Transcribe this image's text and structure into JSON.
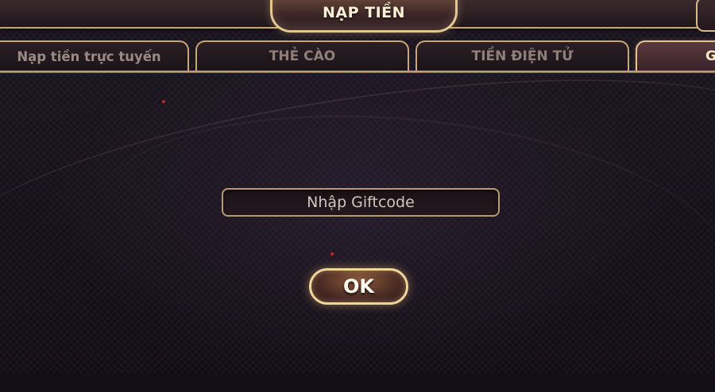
{
  "header": {
    "title": "NẠP TIỀN"
  },
  "tabs": [
    {
      "label": "Nạp tiền trực tuyến",
      "active": false
    },
    {
      "label": "THẺ CÀO",
      "active": false
    },
    {
      "label": "TIỀN ĐIỆN TỬ",
      "active": false
    },
    {
      "label": "G",
      "active": true
    }
  ],
  "giftcode": {
    "placeholder": "Nhập Giftcode",
    "value": ""
  },
  "ok_button": {
    "label": "OK"
  },
  "colors": {
    "gold_border": "#caa575",
    "panel_bg": "#17121b",
    "title_text": "#fbf0d6"
  }
}
